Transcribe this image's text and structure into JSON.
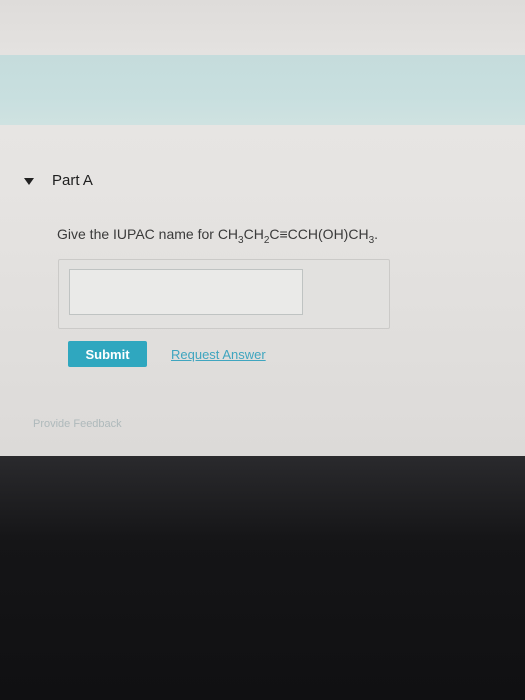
{
  "section": {
    "title": "Part A",
    "expand_icon": "caret-down-icon"
  },
  "question": {
    "prefix": "Give the IUPAC name for ",
    "formula_parts": [
      "CH",
      "3",
      "CH",
      "2",
      "C≡CCH(OH)CH",
      "3",
      "."
    ]
  },
  "answer": {
    "value": "",
    "placeholder": ""
  },
  "actions": {
    "submit_label": "Submit",
    "request_answer_label": "Request Answer",
    "feedback_label": "Provide Feedback"
  },
  "colors": {
    "accent": "#2fa7bf",
    "link": "#3fa5bf",
    "band": "#c8dfdf",
    "page": "#e8e6e4"
  }
}
